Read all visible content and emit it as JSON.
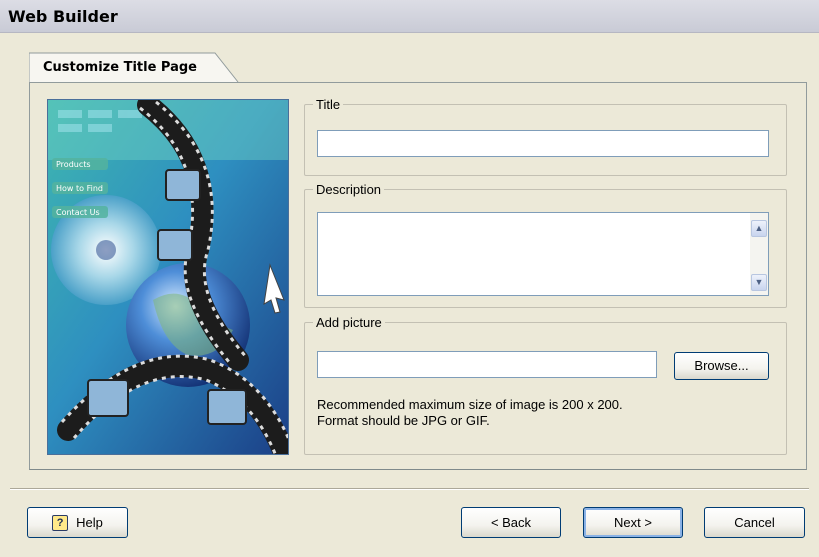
{
  "window": {
    "title": "Web Builder"
  },
  "tab": {
    "label": "Customize Title Page"
  },
  "title_group": {
    "legend": "Title",
    "value": ""
  },
  "description_group": {
    "legend": "Description",
    "value": ""
  },
  "picture_group": {
    "legend": "Add picture",
    "path_value": "",
    "browse_label": "Browse...",
    "note_line1": "Recommended maximum size of image is 200 x 200.",
    "note_line2": "Format should be JPG or GIF."
  },
  "preview_image": {
    "menu_items": [
      "Products",
      "How to Find",
      "Contact Us"
    ]
  },
  "footer": {
    "help_label": "Help",
    "help_icon_glyph": "?",
    "back_label": "< Back",
    "next_label": "Next >",
    "cancel_label": "Cancel"
  },
  "colors": {
    "window_bg": "#ece9d8",
    "titlebar_bg": "#d4d5df",
    "input_border": "#7f9db9",
    "button_border": "#003c74"
  }
}
